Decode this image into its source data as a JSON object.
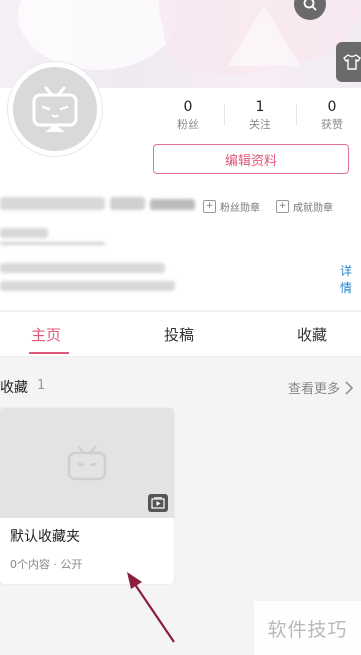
{
  "header": {
    "search_icon": "search-icon",
    "skin_icon": "tshirt-icon"
  },
  "profile": {
    "stats": [
      {
        "value": "0",
        "label": "粉丝"
      },
      {
        "value": "1",
        "label": "关注"
      },
      {
        "value": "0",
        "label": "获赞"
      }
    ],
    "edit_button": "编辑资料",
    "fan_medal": "粉丝勋章",
    "achievement_medal": "成就勋章",
    "detail_link": "详情"
  },
  "tabs": [
    {
      "label": "主页",
      "active": true
    },
    {
      "label": "投稿",
      "active": false
    },
    {
      "label": "收藏",
      "active": false
    }
  ],
  "favorites": {
    "title": "收藏",
    "count": "1",
    "view_more": "查看更多",
    "folders": [
      {
        "name": "默认收藏夹",
        "meta": "0个内容 · 公开"
      }
    ]
  },
  "annotation": {
    "arrow_color": "#8b1e3f"
  },
  "watermark": "软件技巧",
  "colors": {
    "accent": "#e0587a",
    "link": "#2a84c8"
  }
}
